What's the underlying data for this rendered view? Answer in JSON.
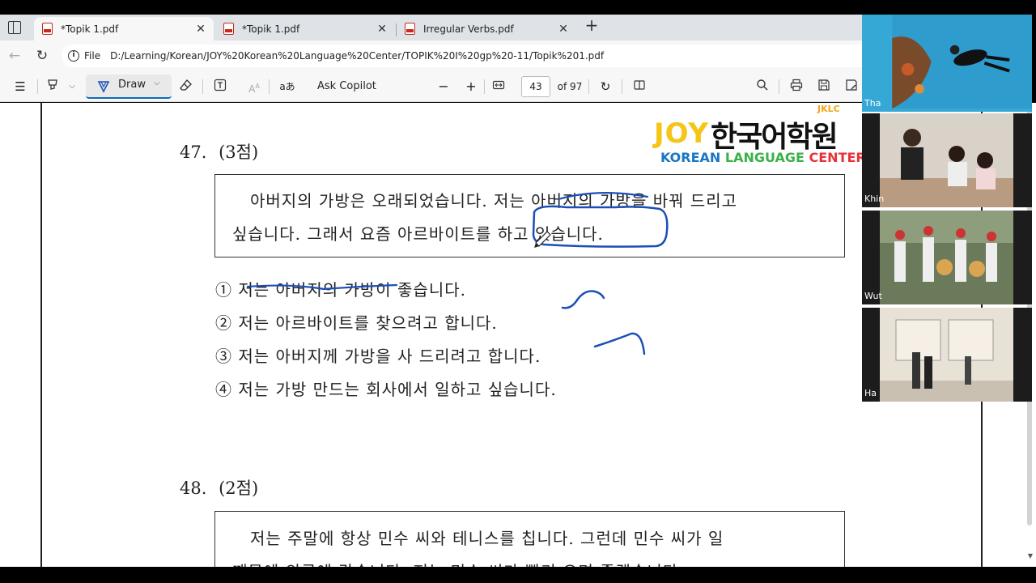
{
  "tabs": [
    {
      "label": "*Topik 1.pdf",
      "active": true
    },
    {
      "label": "*Topik 1.pdf",
      "active": false
    },
    {
      "label": "Irregular Verbs.pdf",
      "active": false
    }
  ],
  "address": {
    "scheme_label": "File",
    "url": "D:/Learning/Korean/JOY%20Korean%20Language%20Center/TOPIK%20I%20gp%20-11/Topik%201.pdf"
  },
  "toolbar": {
    "draw_label": "Draw",
    "copilot_label": "Ask Copilot",
    "zoom_out": "−",
    "zoom_in": "+",
    "page_number": "43",
    "page_total": "of 97"
  },
  "logo": {
    "brand_joy": "JOY",
    "brand_korean": "한국어학원",
    "tag": "JKLC",
    "subtitle_parts": [
      "KOREAN ",
      "LANGUAGE ",
      "CENTER"
    ],
    "colors": {
      "joy": "#f5c518",
      "korean": "#1a75c4",
      "language": "#3bb14a",
      "center": "#e8323a"
    }
  },
  "question47": {
    "number": "47.",
    "points": "(3점)",
    "passage": [
      "아버지의 가방은 오래되었습니다. 저는 아버지의 가방을 바꿔 드리고",
      "싶습니다. 그래서 요즘 아르바이트를 하고 있습니다."
    ],
    "options": [
      "① 저는 아버지의 가방이 좋습니다.",
      "② 저는 아르바이트를 찾으려고 합니다.",
      "③ 저는 아버지께 가방을 사 드리려고 합니다.",
      "④ 저는 가방 만드는 회사에서 일하고 싶습니다."
    ]
  },
  "question48": {
    "number": "48.",
    "points": "(2점)",
    "passage": [
      "저는 주말에 항상 민수 씨와 테니스를 칩니다. 그런데 민수 씨가 일",
      "때문에 외국에 갔습니다. 저는 민수 씨가 빨리 오면 좋겠습니다."
    ]
  },
  "participants": [
    {
      "name": "Tha"
    },
    {
      "name": "Khin"
    },
    {
      "name": "Wut"
    },
    {
      "name": "Ha"
    }
  ],
  "ink_color": "#1a4fb8"
}
